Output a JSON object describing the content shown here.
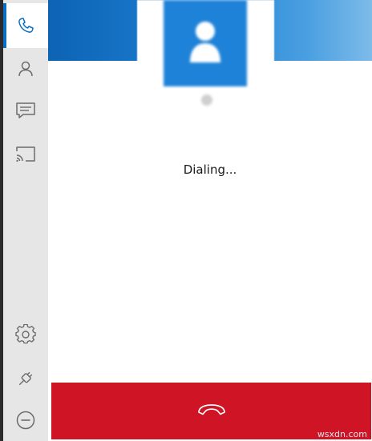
{
  "sidebar": {
    "items": [
      {
        "icon": "phone-icon",
        "active": true
      },
      {
        "icon": "contacts-icon",
        "active": false
      },
      {
        "icon": "messages-icon",
        "active": false
      },
      {
        "icon": "cast-icon",
        "active": false
      }
    ],
    "bottom_items": [
      {
        "icon": "gear-icon"
      },
      {
        "icon": "plug-icon"
      },
      {
        "icon": "disconnect-icon"
      }
    ]
  },
  "call": {
    "status": "Dialing...",
    "hangup_icon": "hang-up-icon"
  },
  "watermark": "wsxdn.com",
  "colors": {
    "accent": "#0a6fc4",
    "banner_blue": "#1c7fd3",
    "hangup_red": "#cf1426",
    "sidebar_bg": "#e6e6e6"
  }
}
